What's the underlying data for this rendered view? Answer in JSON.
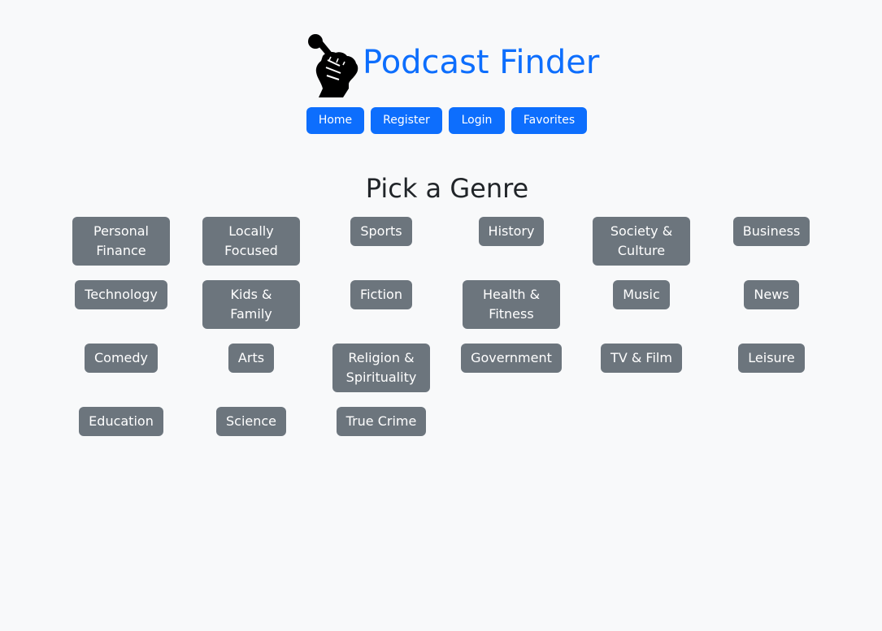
{
  "header": {
    "title": "Podcast Finder",
    "logo_icon": "raised-fist-microphone-icon"
  },
  "nav": {
    "items": [
      {
        "label": "Home"
      },
      {
        "label": "Register"
      },
      {
        "label": "Login"
      },
      {
        "label": "Favorites"
      }
    ]
  },
  "main": {
    "heading": "Pick a Genre",
    "genres": [
      "Personal Finance",
      "Locally Focused",
      "Sports",
      "History",
      "Society & Culture",
      "Business",
      "Technology",
      "Kids & Family",
      "Fiction",
      "Health & Fitness",
      "Music",
      "News",
      "Comedy",
      "Arts",
      "Religion & Spirituality",
      "Government",
      "TV & Film",
      "Leisure",
      "Education",
      "Science",
      "True Crime"
    ]
  },
  "colors": {
    "primary": "#0d6efd",
    "secondary": "#6c757d",
    "background": "#f8f9fa"
  }
}
